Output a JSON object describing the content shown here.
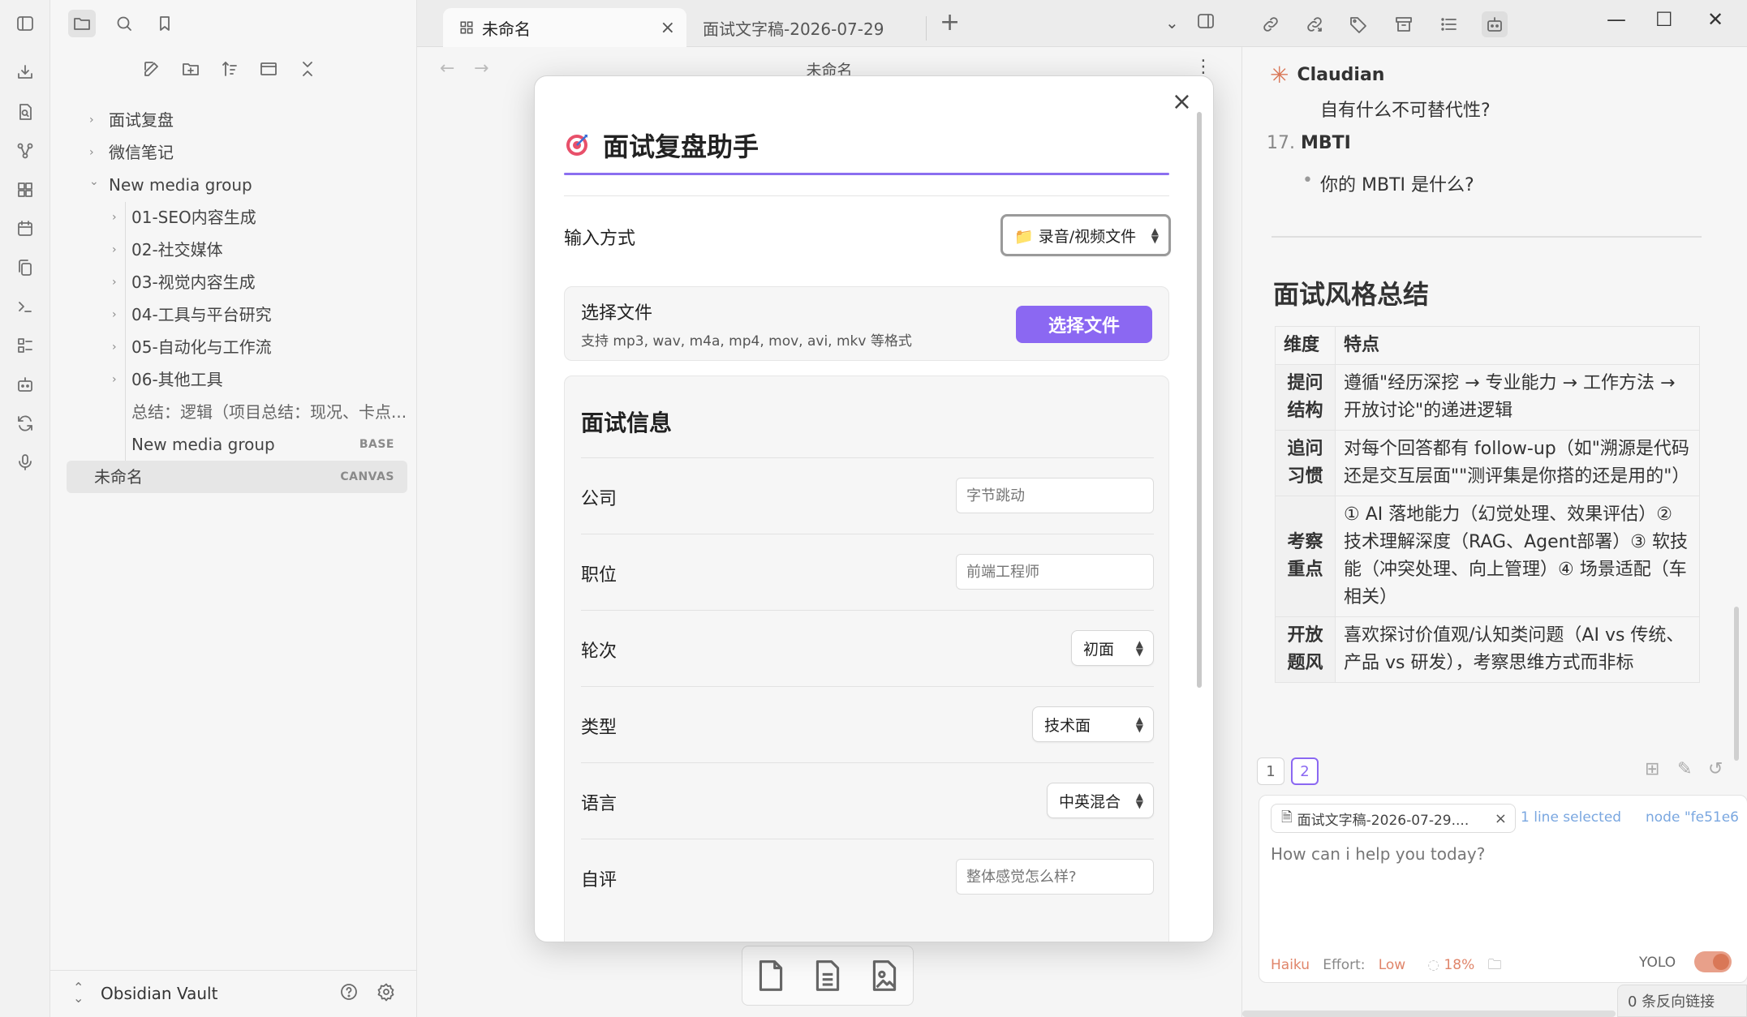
{
  "ribbon": {
    "icons": [
      "download-icon",
      "search-doc-icon",
      "graph-icon",
      "blocks-icon",
      "calendar-icon",
      "copy-icon",
      "terminal-icon",
      "list-icon",
      "bot-icon",
      "sync-icon",
      "mic-icon"
    ]
  },
  "sidebar": {
    "tree": [
      {
        "label": "面试复盘",
        "level": 0,
        "chevron": "›"
      },
      {
        "label": "微信笔记",
        "level": 0,
        "chevron": "›"
      },
      {
        "label": "New media group",
        "level": 0,
        "chevron": "⌄"
      },
      {
        "label": "01-SEO内容生成",
        "level": 1,
        "chevron": "›"
      },
      {
        "label": "02-社交媒体",
        "level": 1,
        "chevron": "›"
      },
      {
        "label": "03-视觉内容生成",
        "level": 1,
        "chevron": "›"
      },
      {
        "label": "04-工具与平台研究",
        "level": 1,
        "chevron": "›"
      },
      {
        "label": "05-自动化与工作流",
        "level": 1,
        "chevron": "›"
      },
      {
        "label": "06-其他工具",
        "level": 1,
        "chevron": "›"
      },
      {
        "label": "总结：逻辑（项目总结：现况、卡点...",
        "level": 1,
        "chevron": ""
      },
      {
        "label": "New media group",
        "level": 1,
        "chevron": "",
        "badge": "BASE"
      },
      {
        "label": "未命名",
        "level": 0,
        "chevron": "",
        "badge": "CANVAS",
        "selected": true
      }
    ],
    "vault_name": "Obsidian Vault"
  },
  "tabs": {
    "active_label": "未命名",
    "second_label": "面试文字稿-2026-07-29",
    "close": "×",
    "new_tab": "+"
  },
  "center": {
    "title": "未命名"
  },
  "modal": {
    "close": "×",
    "title": "面试复盘助手",
    "input_method_label": "输入方式",
    "input_method_value": "📁 录音/视频文件",
    "file_title": "选择文件",
    "file_sub": "支持 mp3, wav, m4a, mp4, mov, avi, mkv 等格式",
    "file_button": "选择文件",
    "info_heading": "面试信息",
    "fields": {
      "company": {
        "label": "公司",
        "placeholder": "字节跳动"
      },
      "position": {
        "label": "职位",
        "placeholder": "前端工程师"
      },
      "round": {
        "label": "轮次",
        "value": "初面"
      },
      "type": {
        "label": "类型",
        "value": "技术面"
      },
      "language": {
        "label": "语言",
        "value": "中英混合"
      },
      "self_eval": {
        "label": "自评",
        "placeholder": "整体感觉怎么样?"
      }
    }
  },
  "right": {
    "assistant_name": "Claudian",
    "lines": {
      "q_top": "自有什么不可替代性?",
      "num17": "17.",
      "mbti": "MBTI",
      "bullet": "你的 MBTI 是什么?"
    },
    "section_title": "面试风格总结",
    "table": {
      "headers": [
        "维度",
        "特点"
      ],
      "rows": [
        [
          "提问结构",
          "遵循\"经历深挖 → 专业能力 → 工作方法 → 开放讨论\"的递进逻辑"
        ],
        [
          "追问习惯",
          "对每个回答都有 follow-up（如\"溯源是代码还是交互层面\"\"测评集是你搭的还是用的\"）"
        ],
        [
          "考察重点",
          "① AI 落地能力（幻觉处理、效果评估）② 技术理解深度（RAG、Agent部署）③ 软技能（冲突处理、向上管理）④ 场景适配（车相关）"
        ],
        [
          "开放题风",
          "喜欢探讨价值观/认知类问题（AI vs 传统、产品 vs 研发），考察思维方式而非标"
        ]
      ]
    },
    "pages": [
      "1",
      "2"
    ],
    "chat": {
      "file_chip": "面试文字稿-2026-07-29....",
      "selection": "1 line selected",
      "node": "node \"fe51e6",
      "placeholder": "How can i help you today?",
      "model": "Haiku",
      "effort_label": "Effort:",
      "effort_value": "Low",
      "context": "18%",
      "yolo": "YOLO"
    },
    "status": "0 条反向链接"
  },
  "window": {
    "minimize": "—",
    "maximize": "☐",
    "close": "✕"
  }
}
